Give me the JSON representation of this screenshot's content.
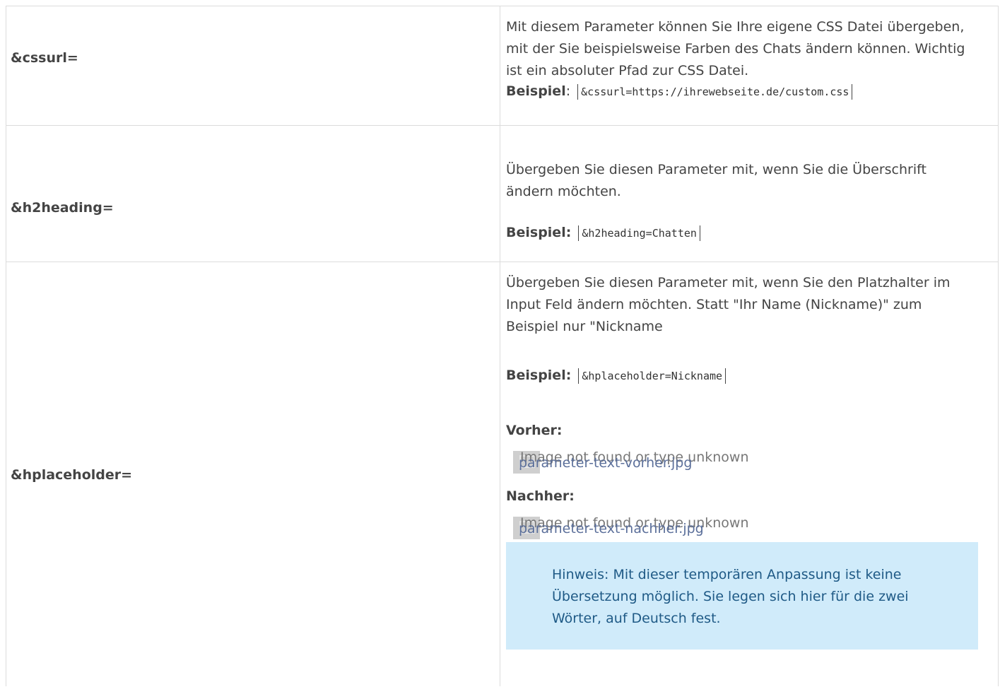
{
  "rows": [
    {
      "param": "&cssurl=",
      "desc": "Mit diesem Parameter können Sie Ihre eigene CSS Datei übergeben, mit der Sie beispielsweise Farben des Chats ändern können. Wichtig ist ein absoluter Pfad zur CSS Datei.",
      "example_label": "Beispiel",
      "example_sep": ":",
      "example_code": "&cssurl=https://ihrewebseite.de/custom.css"
    },
    {
      "param": "&h2heading=",
      "desc": "Übergeben Sie diesen Parameter mit, wenn Sie die Überschrift ändern möchten.",
      "example_label": "Beispiel:",
      "example_code": "&h2heading=Chatten"
    },
    {
      "param": "&hplaceholder=",
      "desc": "Übergeben Sie diesen Parameter mit, wenn Sie den Platzhalter im Input Feld ändern möchten. Statt \"Ihr Name (Nickname)\" zum Beispiel nur \"Nickname",
      "example_label": "Beispiel:",
      "example_code": "&hplaceholder=Nickname",
      "before_label": "Vorher:",
      "before_image_alt": "Image not found or type unknown",
      "before_image_name": "parameter-text-vorher.jpg",
      "after_label": "Nachher:",
      "after_image_alt": "Image not found or type unknown",
      "after_image_name": "parameter-text-nachher.jpg",
      "note": "Hinweis: Mit dieser temporären Anpassung ist keine Übersetzung möglich. Sie legen sich hier für die zwei Wörter, auf Deutsch fest."
    }
  ],
  "colors": {
    "border": "#dcdcdc",
    "text": "#444444",
    "note_bg": "#d0ebfa",
    "note_text": "#1f5a86"
  }
}
